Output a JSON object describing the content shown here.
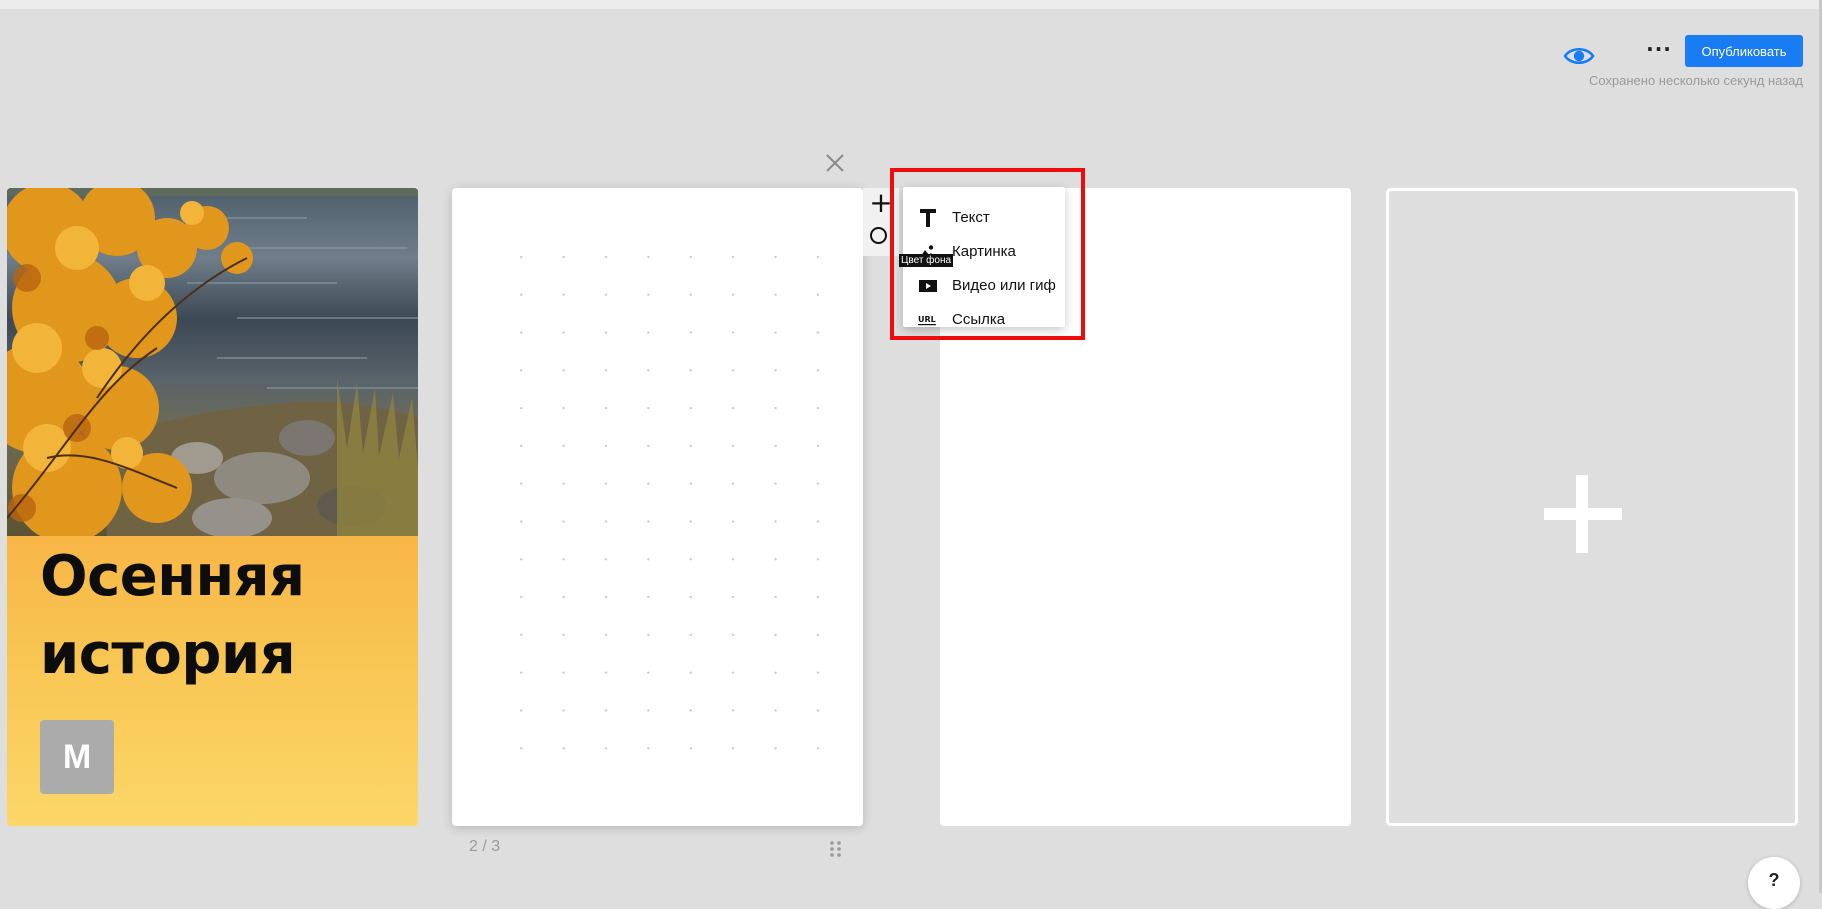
{
  "header": {
    "preview_icon": "eye-icon",
    "more_icon": "ellipsis-icon",
    "more_label": "···",
    "publish_label": "Опубликовать",
    "saved_status": "Сохранено несколько секунд назад",
    "accent_color": "#1a7cf2"
  },
  "editor": {
    "close_icon": "close-icon",
    "page_counter": "2 / 3",
    "drag_icon": "drag-handle-icon",
    "help_label": "?"
  },
  "slides": {
    "cover": {
      "title": "Осенняя история",
      "avatar_letter": "M",
      "image": "autumn-lake-photo"
    }
  },
  "tools": {
    "add_label": "+",
    "bg_tooltip": "Цвет фона"
  },
  "add_menu": {
    "items": [
      {
        "label": "Текст",
        "icon": "text-icon"
      },
      {
        "label": "Картинка",
        "icon": "image-icon"
      },
      {
        "label": "Видео или гиф",
        "icon": "video-icon"
      },
      {
        "label": "Ссылка",
        "icon": "url-icon"
      }
    ],
    "highlight_color": "#ee0c0c"
  }
}
